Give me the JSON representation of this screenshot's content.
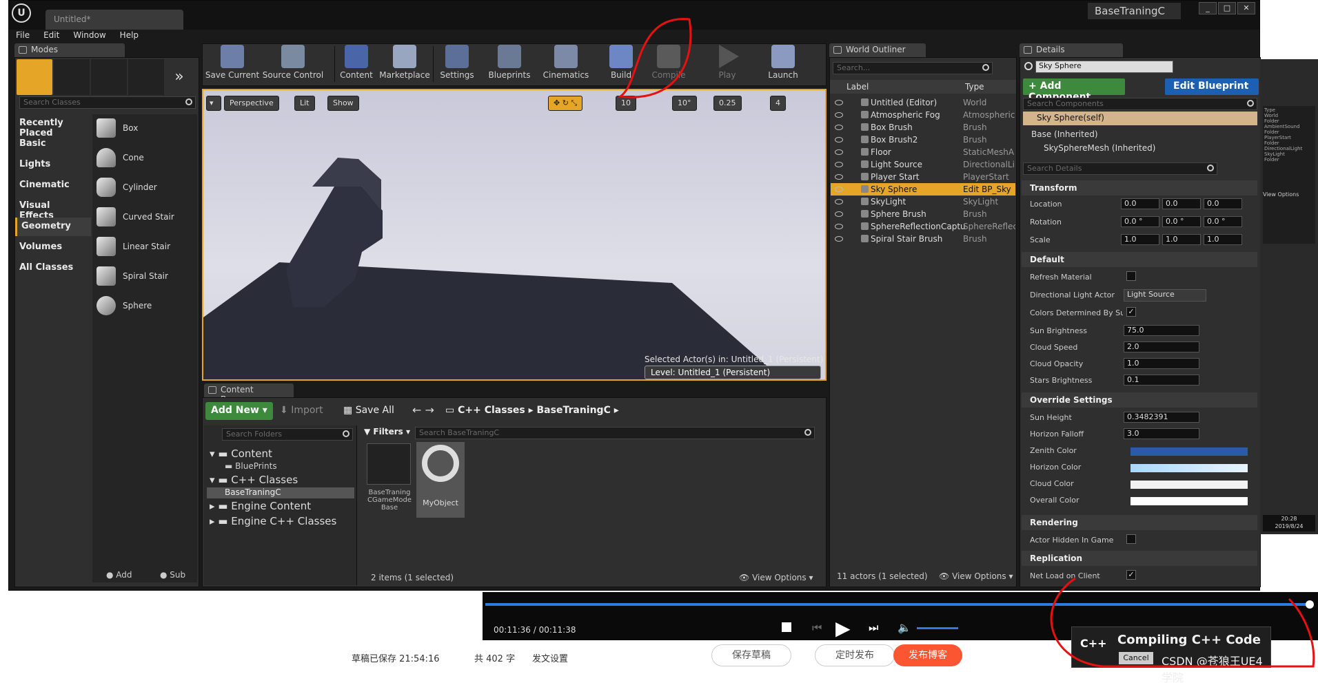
{
  "window": {
    "document_tab": "Untitled*",
    "project_name": "BaseTraningC",
    "menu": [
      "File",
      "Edit",
      "Window",
      "Help"
    ]
  },
  "modes": {
    "tab": "Modes",
    "search_placeholder": "Search Classes",
    "categories": [
      "Recently Placed",
      "Basic",
      "Lights",
      "Cinematic",
      "Visual Effects",
      "Geometry",
      "Volumes",
      "All Classes"
    ],
    "selected_category": "Geometry",
    "items": [
      "Box",
      "Cone",
      "Cylinder",
      "Curved Stair",
      "Linear Stair",
      "Spiral Stair",
      "Sphere"
    ],
    "footer_add": "Add",
    "footer_sub": "Sub"
  },
  "toolbar": {
    "buttons": [
      "Save Current",
      "Source Control",
      "Content",
      "Marketplace",
      "Settings",
      "Blueprints",
      "Cinematics",
      "Build",
      "Compile",
      "Play",
      "Launch"
    ]
  },
  "viewport": {
    "perspective": "Perspective",
    "lit": "Lit",
    "show": "Show",
    "grid_snap": "10",
    "rot_snap": "10°",
    "scale_snap": "0.25",
    "cam_speed": "4",
    "selected_actors": "Selected Actor(s) in:  Untitled_1 (Persistent)",
    "level": "Level:  Untitled_1 (Persistent)"
  },
  "outliner": {
    "tab": "World Outliner",
    "search_placeholder": "Search...",
    "col_label": "Label",
    "col_type": "Type",
    "rows": [
      {
        "label": "Untitled (Editor)",
        "type": "World"
      },
      {
        "label": "Atmospheric Fog",
        "type": "Atmospheric"
      },
      {
        "label": "Box Brush",
        "type": "Brush"
      },
      {
        "label": "Box Brush2",
        "type": "Brush"
      },
      {
        "label": "Floor",
        "type": "StaticMeshA"
      },
      {
        "label": "Light Source",
        "type": "DirectionalLi"
      },
      {
        "label": "Player Start",
        "type": "PlayerStart"
      },
      {
        "label": "Sky Sphere",
        "type": "Edit BP_Sky"
      },
      {
        "label": "SkyLight",
        "type": "SkyLight"
      },
      {
        "label": "Sphere Brush",
        "type": "Brush"
      },
      {
        "label": "SphereReflectionCaptu",
        "type": "SphereReflec"
      },
      {
        "label": "Spiral Stair Brush",
        "type": "Brush"
      }
    ],
    "status": "11 actors (1 selected)",
    "view_options": "View Options"
  },
  "details": {
    "tab": "Details",
    "name": "Sky Sphere",
    "add_component": "+ Add Component",
    "edit_blueprint": "Edit Blueprint",
    "search_components": "Search Components",
    "self": "Sky Sphere(self)",
    "base": "Base (Inherited)",
    "mesh": "SkySphereMesh (Inherited)",
    "search_details": "Search Details",
    "transform": "Transform",
    "location": "Location",
    "rotation": "Rotation",
    "scale": "Scale",
    "loc": [
      "0.0",
      "0.0",
      "0.0"
    ],
    "rot": [
      "0.0 °",
      "0.0 °",
      "0.0 °"
    ],
    "scl": [
      "1.0",
      "1.0",
      "1.0"
    ],
    "default": "Default",
    "refresh_material": "Refresh Material",
    "directional_light_actor": "Directional Light Actor",
    "light_source_value": "Light Source",
    "colors_determined": "Colors Determined By Sun",
    "sun_brightness": "Sun Brightness",
    "sun_brightness_v": "75.0",
    "cloud_speed": "Cloud Speed",
    "cloud_speed_v": "2.0",
    "cloud_opacity": "Cloud Opacity",
    "cloud_opacity_v": "1.0",
    "stars_brightness": "Stars Brightness",
    "stars_brightness_v": "0.1",
    "override": "Override Settings",
    "sun_height": "Sun Height",
    "sun_height_v": "0.3482391",
    "horizon_falloff": "Horizon Falloff",
    "horizon_falloff_v": "3.0",
    "zenith_color": "Zenith Color",
    "horizon_color": "Horizon Color",
    "cloud_color": "Cloud Color",
    "overall_color": "Overall Color",
    "rendering": "Rendering",
    "actor_hidden": "Actor Hidden In Game",
    "replication": "Replication",
    "net_load": "Net Load on Client",
    "zenith_hex": "#2a5aa8",
    "horizon_hex": "#a8d8ff"
  },
  "content_browser": {
    "tab": "Content Browser",
    "add_new": "Add New",
    "import": "Import",
    "save_all": "Save All",
    "path": [
      "C++ Classes",
      "BaseTraningC"
    ],
    "search_folders": "Search Folders",
    "filters": "Filters",
    "search_assets": "Search BaseTraningC",
    "tree": [
      "Content",
      "BluePrints",
      "C++ Classes",
      "BaseTraningC",
      "Engine Content",
      "Engine C++ Classes"
    ],
    "assets": [
      "BaseTraning CGameMode Base",
      "MyObject"
    ],
    "status": "2 items (1 selected)",
    "view_options": "View Options"
  },
  "video": {
    "time": "00:11:36 /   00:11:38"
  },
  "toast": {
    "badge": "C++",
    "title": "Compiling C++ Code",
    "cancel": "Cancel",
    "watermark": "CSDN @苍狼王UE4学院"
  },
  "bottom": {
    "saved": "草稿已保存 21:54:16",
    "count": "共 402 字",
    "publish_settings": "发文设置",
    "save_draft": "保存草稿",
    "schedule": "定时发布",
    "publish": "发布博客"
  },
  "mini_panel": {
    "clock_time": "20:28",
    "clock_date": "2019/8/24",
    "view_options": "View Options",
    "type_header": "Type",
    "type_rows": [
      "World",
      "Folder",
      "AmbientSound",
      "Folder",
      "PlayerStart",
      "Folder",
      "DirectionalLight",
      "SkyLight",
      "Folder"
    ]
  }
}
